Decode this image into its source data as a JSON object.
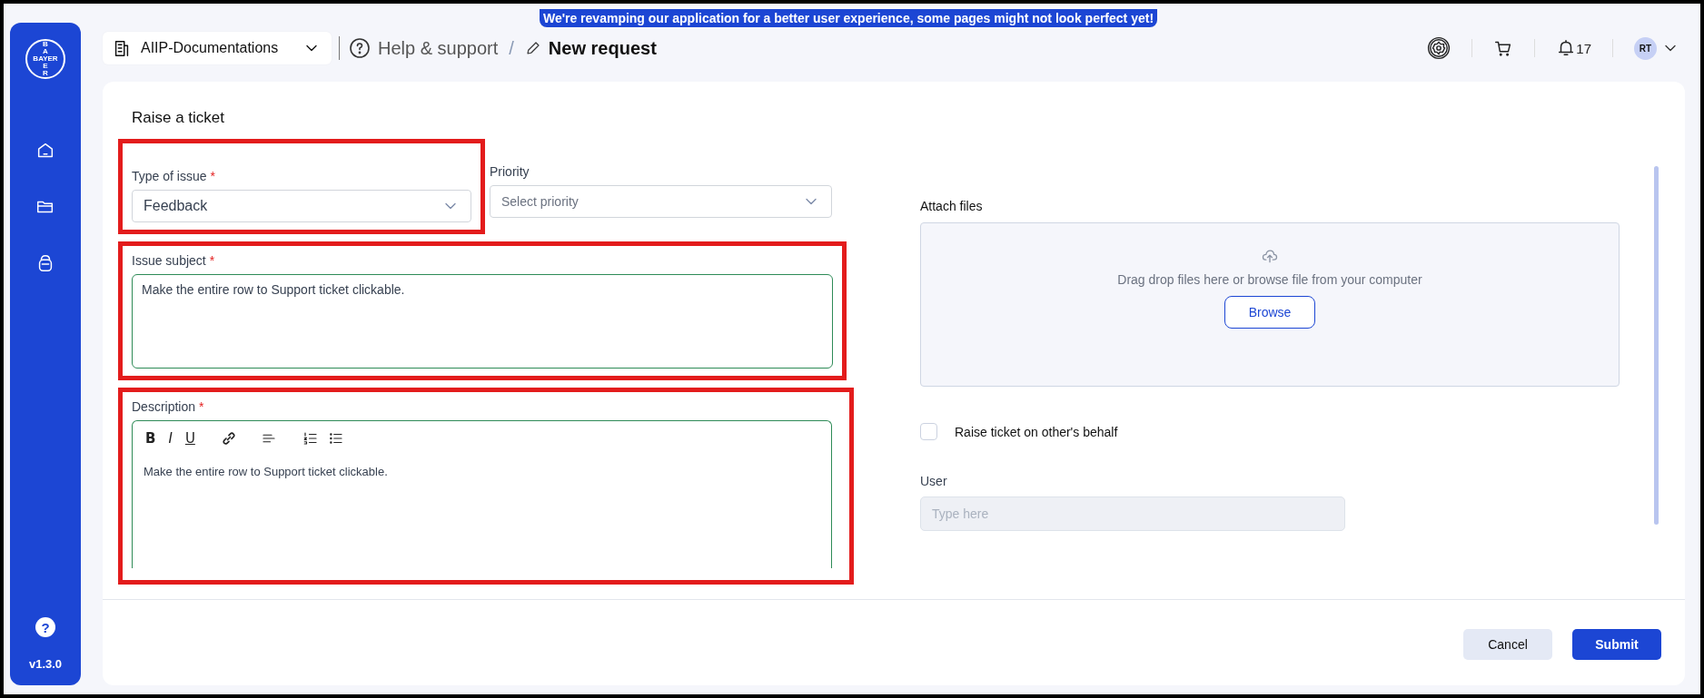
{
  "banner": {
    "text": "We're revamping our application for a better user experience, some pages might not look perfect yet!"
  },
  "sidebar": {
    "logo": {
      "across": "BAYER",
      "above": "BA",
      "below": "ER"
    },
    "help": "?",
    "version": "v1.3.0"
  },
  "header": {
    "workspace": "AIIP-Documentations",
    "breadcrumb": [
      {
        "label": "Help & support",
        "current": false
      },
      {
        "label": "New request",
        "current": true
      }
    ],
    "breadcrumb_separator": "/",
    "notifications": "17",
    "avatar": "RT"
  },
  "form": {
    "title": "Raise a ticket",
    "type_of_issue": {
      "label": "Type of issue",
      "required_mark": "*",
      "value": "Feedback",
      "highlighted": true
    },
    "priority": {
      "label": "Priority",
      "placeholder": "Select priority",
      "highlighted": false
    },
    "issue_subject": {
      "label": "Issue subject",
      "required_mark": "*",
      "value": "Make the entire row to Support ticket clickable.",
      "highlighted": true
    },
    "description": {
      "label": "Description",
      "required_mark": "*",
      "value": "Make the entire row to Support ticket clickable.",
      "highlighted": true,
      "toolbar": [
        {
          "kind": "bold",
          "label": "B"
        },
        {
          "kind": "italic",
          "label": "I"
        },
        {
          "kind": "underline",
          "label": "U"
        },
        {
          "kind": "link"
        },
        {
          "kind": "align"
        },
        {
          "kind": "ordered"
        },
        {
          "kind": "bullet"
        }
      ]
    },
    "attach": {
      "label": "Attach files",
      "hint": "Drag drop files here or browse file from your computer",
      "button": "Browse"
    },
    "on_behalf": {
      "label": "Raise ticket on other's behalf",
      "checked": false
    },
    "user": {
      "label": "User",
      "placeholder": "Type here",
      "disabled": true
    }
  },
  "footer": {
    "buttons": [
      {
        "kind": "secondary",
        "label": "Cancel"
      },
      {
        "kind": "primary",
        "label": "Submit"
      }
    ]
  }
}
